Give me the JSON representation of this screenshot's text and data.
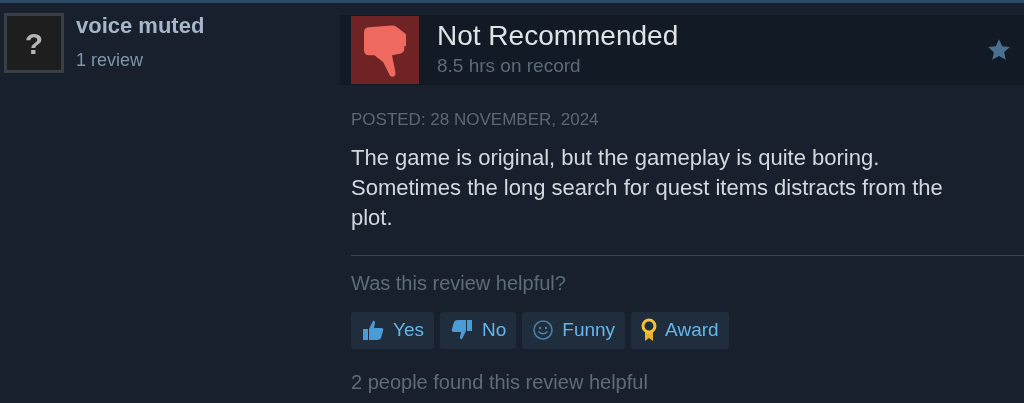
{
  "author": {
    "name": "voice muted",
    "reviews": "1 review",
    "avatar_glyph": "?"
  },
  "review": {
    "verdict": "Not Recommended",
    "recommended": false,
    "hours": "8.5 hrs on record",
    "posted": "POSTED: 28 NOVEMBER, 2024",
    "text": "The game is original, but the gameplay is quite boring. Sometimes the long search for quest items distracts from the plot."
  },
  "helpful": {
    "question": "Was this review helpful?",
    "buttons": [
      {
        "kind": "yes",
        "label": "Yes"
      },
      {
        "kind": "no",
        "label": "No"
      },
      {
        "kind": "funny",
        "label": "Funny"
      },
      {
        "kind": "award",
        "label": "Award"
      }
    ],
    "summary": "2 people found this review helpful"
  }
}
